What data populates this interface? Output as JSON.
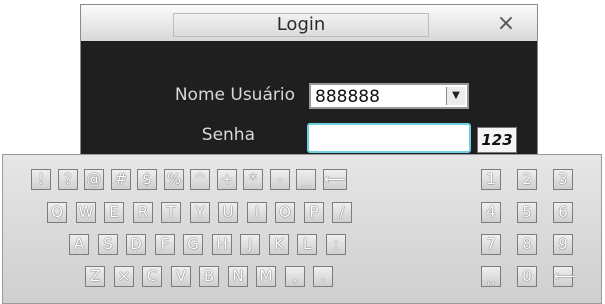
{
  "dialog": {
    "title": "Login",
    "close_icon": "close-icon",
    "user_label": "Nome Usuário",
    "user_value": "888888",
    "pass_label": "Senha",
    "mode_button_label": "123"
  },
  "keyboard": {
    "row1": [
      "!",
      "?",
      "@",
      "#",
      "$",
      "%",
      "^",
      "+",
      "*",
      "-",
      "_",
      "⟵"
    ],
    "row2": [
      "Q",
      "W",
      "E",
      "R",
      "T",
      "Y",
      "U",
      "I",
      "O",
      "P",
      "/"
    ],
    "row3": [
      "A",
      "S",
      "D",
      "F",
      "G",
      "H",
      "J",
      "K",
      "L",
      ":"
    ],
    "row4": [
      "Z",
      "×",
      "C",
      "V",
      "B",
      "N",
      "M",
      ",",
      "."
    ],
    "numpad": [
      [
        "1",
        "2",
        "3"
      ],
      [
        "4",
        "5",
        "6"
      ],
      [
        "7",
        "8",
        "9"
      ],
      [
        "⎵",
        "0",
        "⟵"
      ]
    ]
  },
  "colors": {
    "dialog_bg": "#1f1f1f",
    "input_focus": "#6fd0e0"
  }
}
